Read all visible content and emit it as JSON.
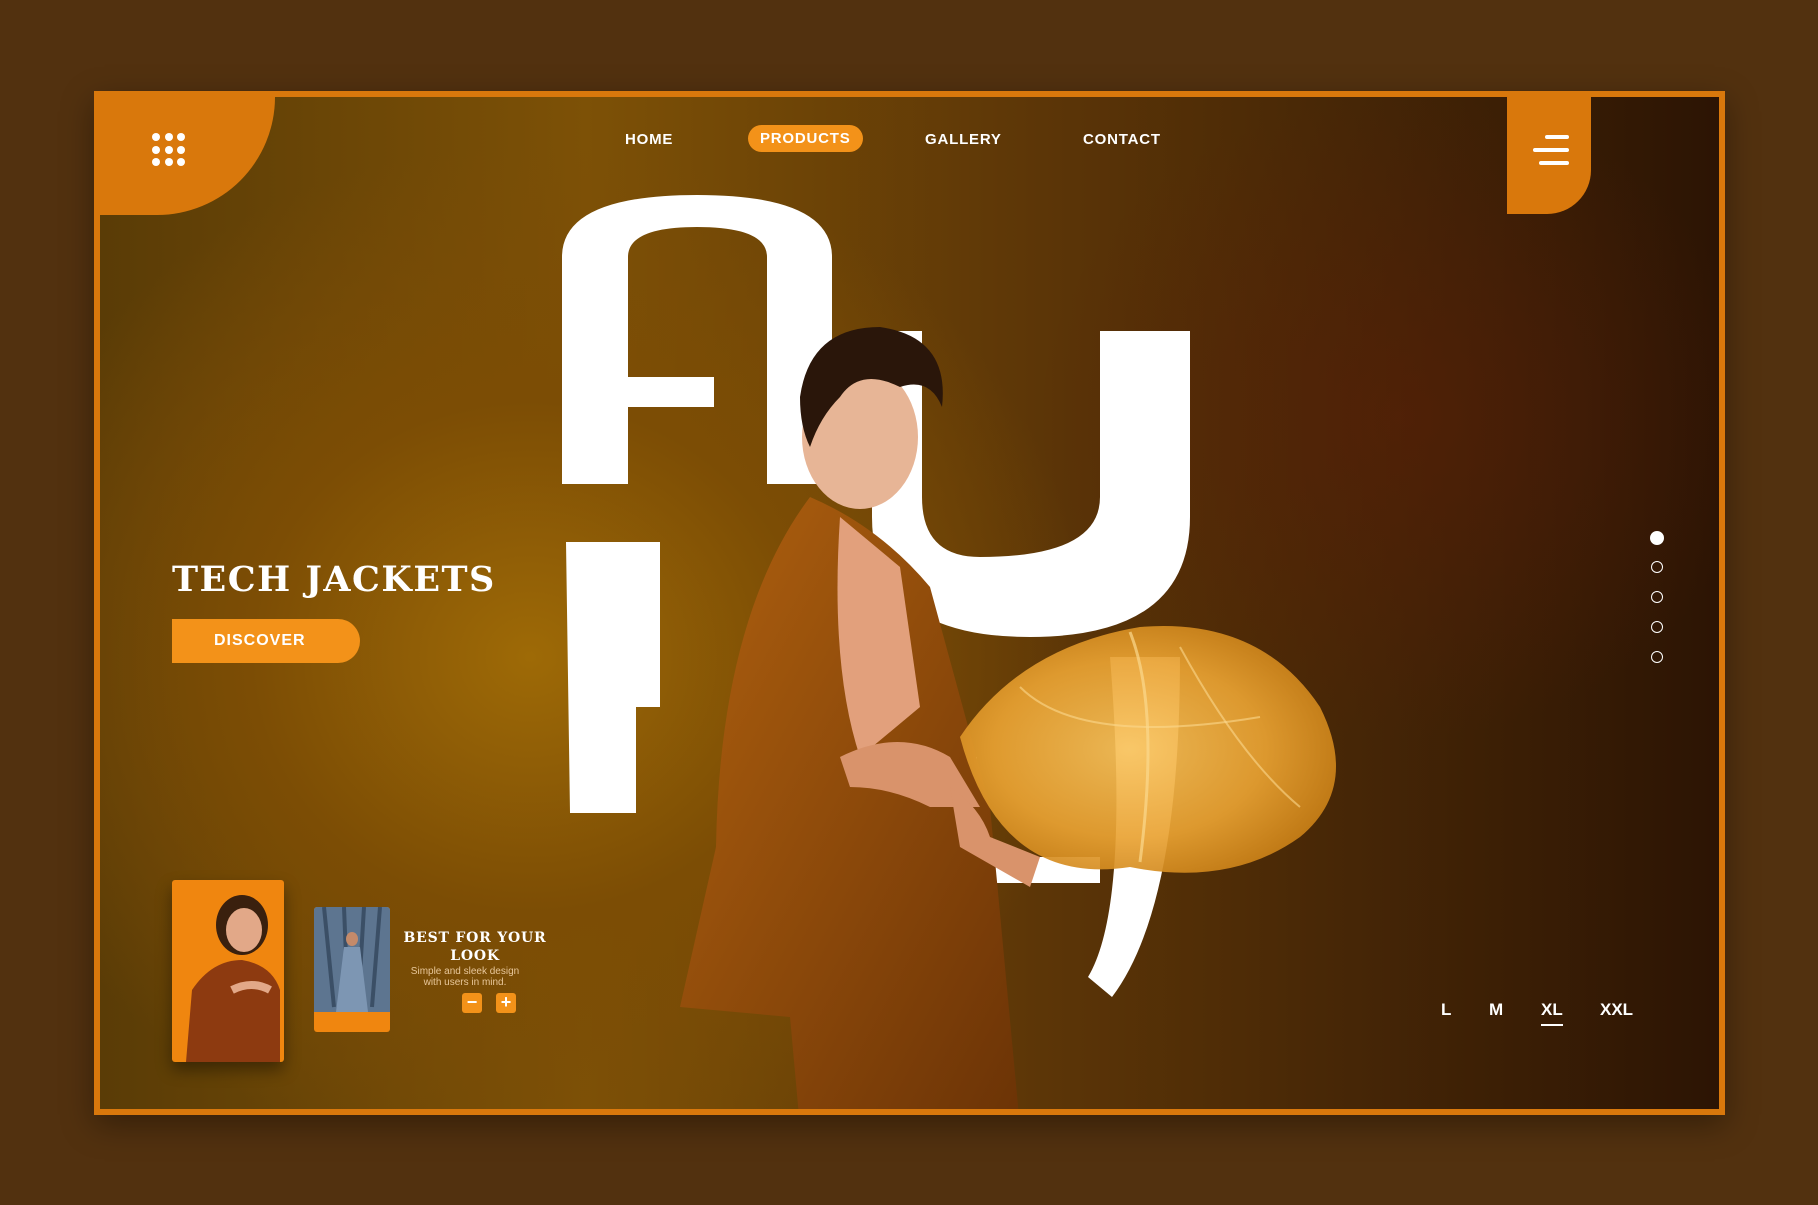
{
  "nav": {
    "items": [
      "HOME",
      "PRODUCTS",
      "GALLERY",
      "CONTACT"
    ],
    "active": "PRODUCTS"
  },
  "hero": {
    "title": "TECH JACKETS",
    "cta": "DISCOVER"
  },
  "product": {
    "title": "BEST FOR YOUR LOOK",
    "subtitle_line1": "Simple and sleek design",
    "subtitle_line2": "with users in mind.",
    "minus": "−",
    "plus": "+"
  },
  "sizes": [
    "L",
    "M",
    "XL",
    "XXL"
  ],
  "selected_size": "XL",
  "slider": {
    "count": 5,
    "active": 1
  },
  "icons": [
    "apps-grid-icon",
    "hamburger-menu-icon",
    "minus-icon",
    "plus-icon"
  ],
  "colors": {
    "accent": "#f39219",
    "frame": "#d9780c",
    "background": "#52310f"
  }
}
